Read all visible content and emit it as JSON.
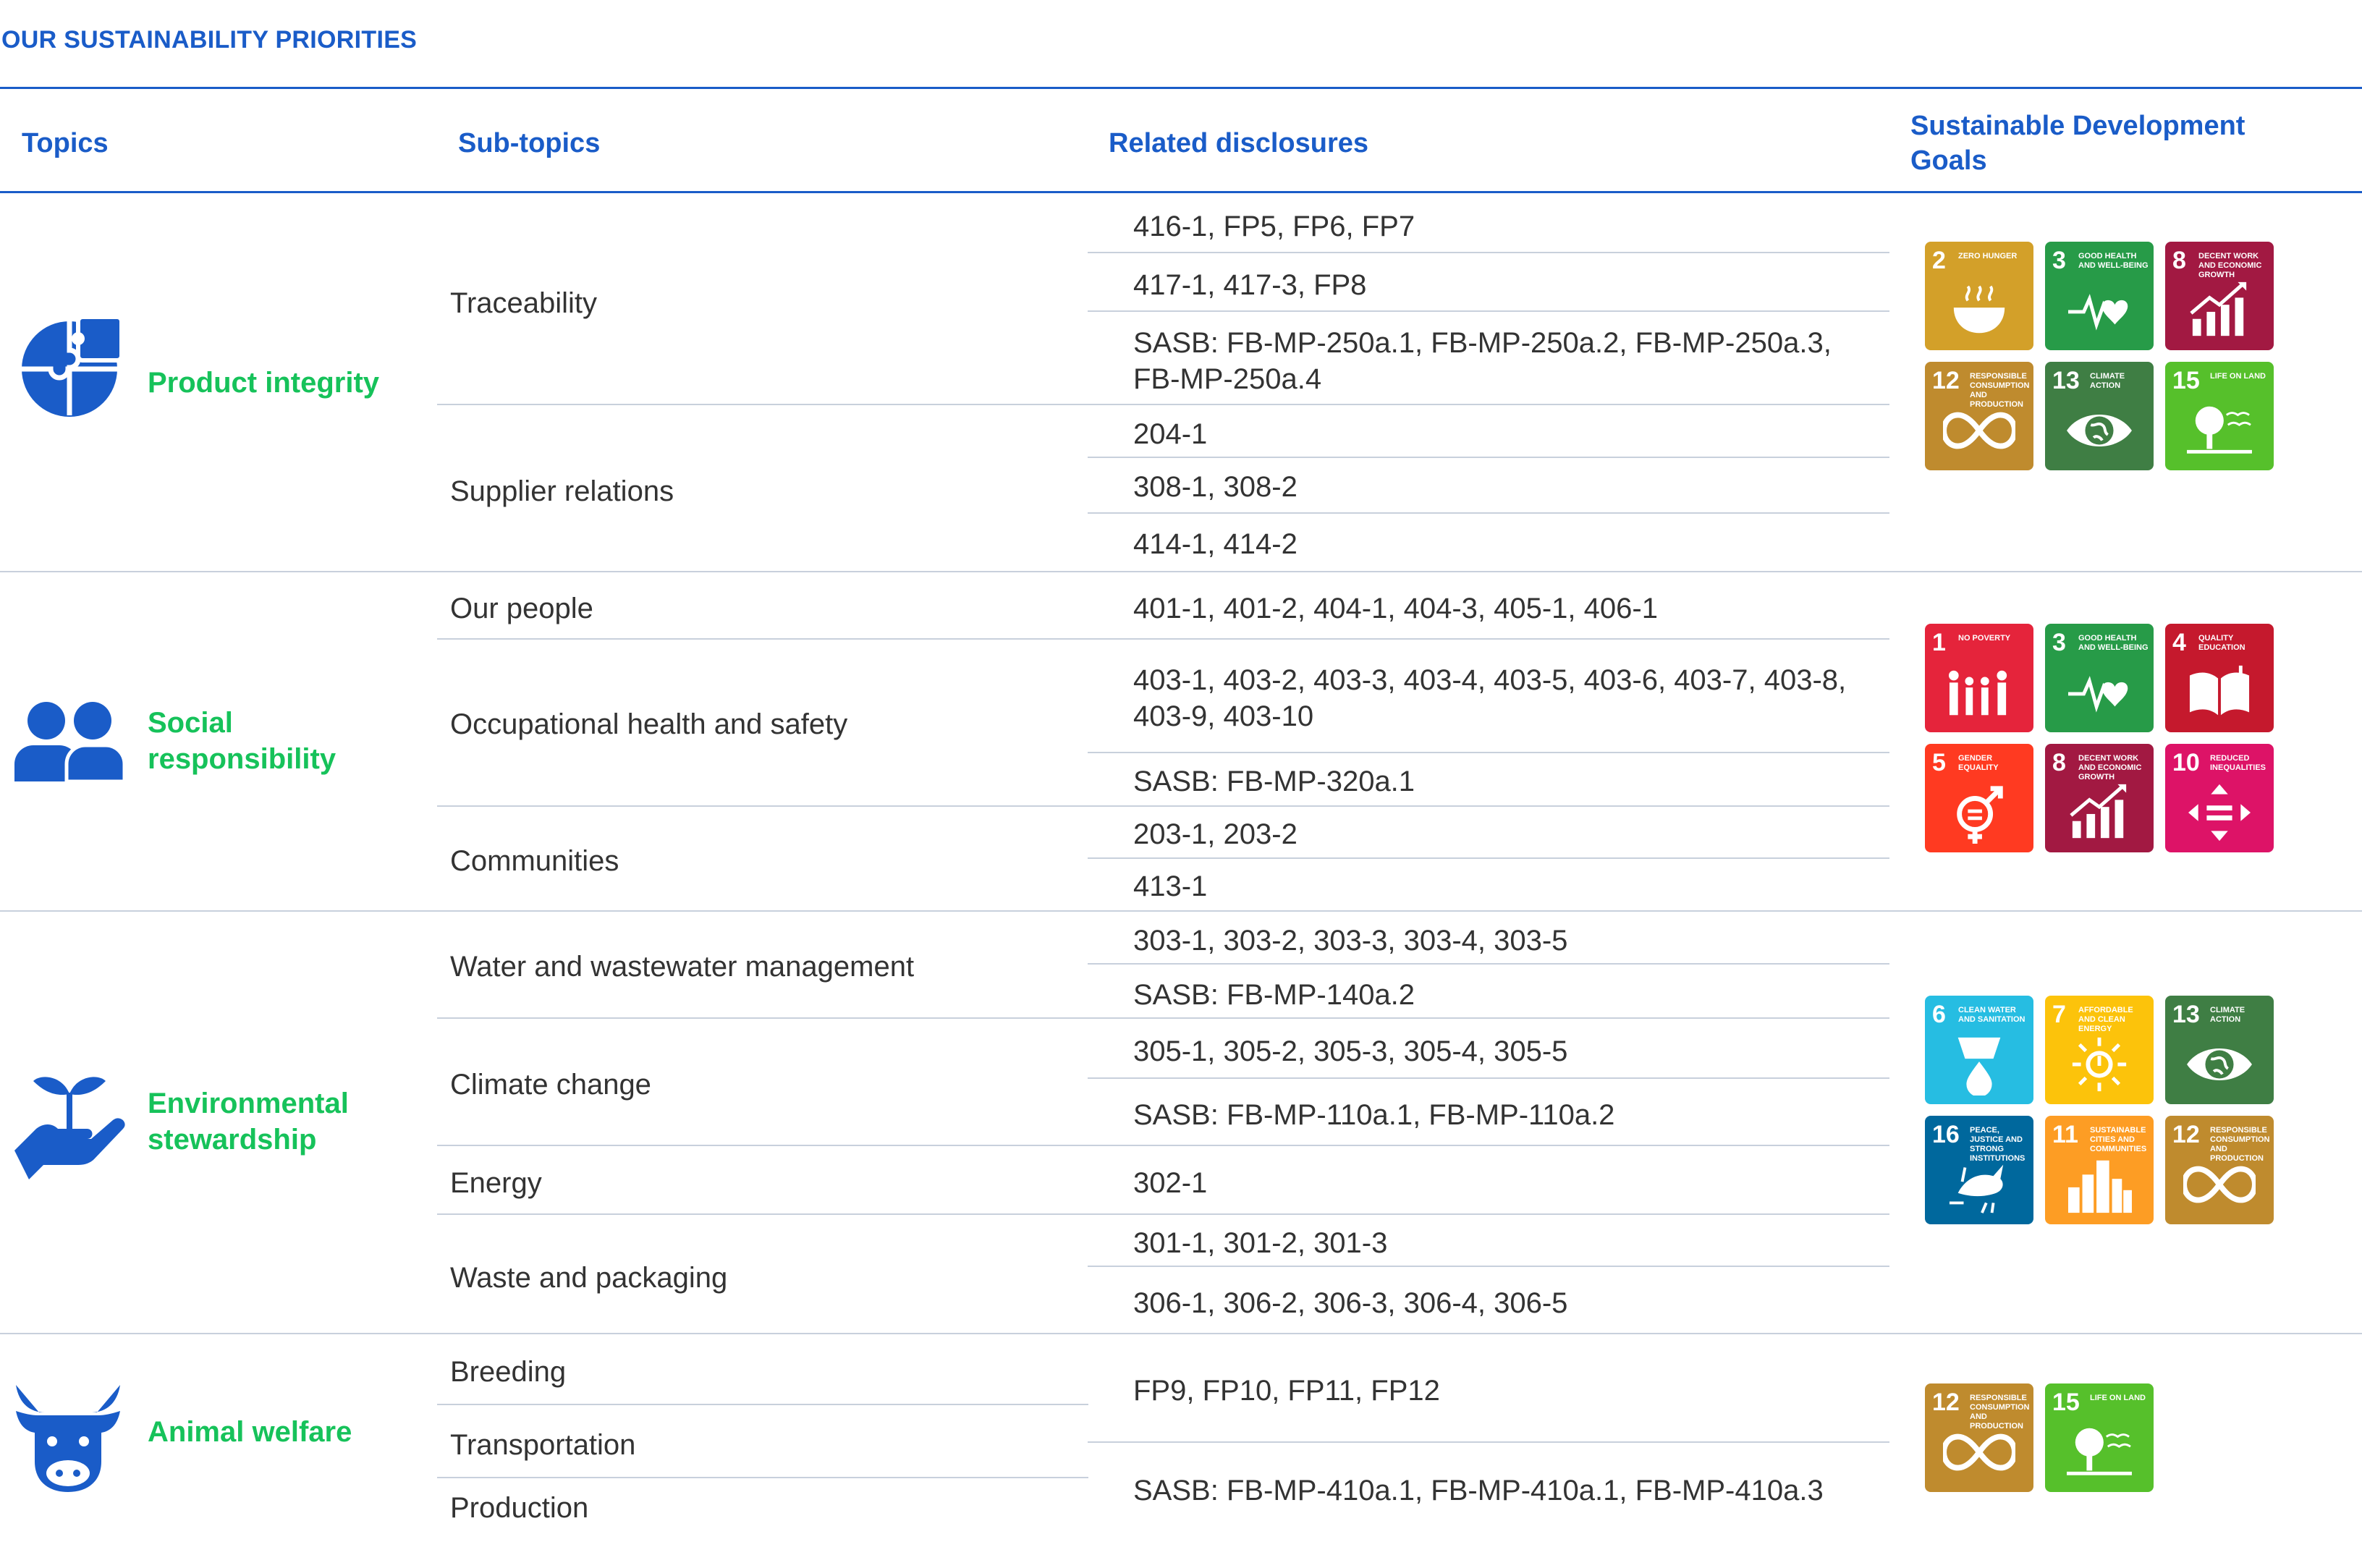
{
  "page_title": "OUR SUSTAINABILITY PRIORITIES",
  "headers": {
    "topics": "Topics",
    "subtopics": "Sub-topics",
    "disclosures": "Related disclosures",
    "sdg": "Sustainable Development Goals"
  },
  "colors": {
    "header_blue": "#1a5cc8",
    "topic_green": "#16c25a",
    "icon_blue": "#1a5cc8"
  },
  "sections": [
    {
      "topic": "Product integrity",
      "icon": "puzzle-globe-icon",
      "subtopics": [
        "Traceability",
        "Supplier relations"
      ],
      "disclosures": [
        "416-1, FP5, FP6, FP7",
        "417-1, 417-3, FP8",
        "SASB: FB-MP-250a.1, FB-MP-250a.2, FB-MP-250a.3, FB-MP-250a.4",
        "204-1",
        "308-1, 308-2",
        "414-1, 414-2"
      ],
      "sdgs": [
        {
          "num": "2",
          "label": "Zero hunger",
          "color": "#D3A029",
          "icon": "bowl-icon"
        },
        {
          "num": "3",
          "label": "Good health and well-being",
          "color": "#279B48",
          "icon": "heartbeat-icon"
        },
        {
          "num": "8",
          "label": "Decent work and economic growth",
          "color": "#A21942",
          "icon": "growth-chart-icon"
        },
        {
          "num": "12",
          "label": "Responsible consumption and production",
          "color": "#BF8B2E",
          "icon": "infinity-icon"
        },
        {
          "num": "13",
          "label": "Climate action",
          "color": "#3F7E44",
          "icon": "eye-globe-icon"
        },
        {
          "num": "15",
          "label": "Life on land",
          "color": "#56C02B",
          "icon": "tree-icon"
        }
      ]
    },
    {
      "topic": "Social responsibility",
      "icon": "people-icon",
      "subtopics": [
        "Our people",
        "Occupational health and safety",
        "Communities"
      ],
      "disclosures": [
        "401-1, 401-2, 404-1, 404-3, 405-1, 406-1",
        "403-1, 403-2, 403-3, 403-4, 403-5, 403-6, 403-7, 403-8, 403-9, 403-10",
        "SASB: FB-MP-320a.1",
        "203-1, 203-2",
        "413-1"
      ],
      "sdgs": [
        {
          "num": "1",
          "label": "No poverty",
          "color": "#E5243B",
          "icon": "family-icon"
        },
        {
          "num": "3",
          "label": "Good health and well-being",
          "color": "#279B48",
          "icon": "heartbeat-icon"
        },
        {
          "num": "4",
          "label": "Quality education",
          "color": "#C5192D",
          "icon": "book-icon"
        },
        {
          "num": "5",
          "label": "Gender equality",
          "color": "#FF3A21",
          "icon": "gender-icon"
        },
        {
          "num": "8",
          "label": "Decent work and economic growth",
          "color": "#A21942",
          "icon": "growth-chart-icon"
        },
        {
          "num": "10",
          "label": "Reduced inequalities",
          "color": "#DD1367",
          "icon": "equality-arrows-icon"
        }
      ]
    },
    {
      "topic": "Environmental stewardship",
      "icon": "hand-plant-icon",
      "subtopics": [
        "Water and wastewater management",
        "Climate change",
        "Energy",
        "Waste and packaging"
      ],
      "disclosures": [
        "303-1, 303-2, 303-3, 303-4, 303-5",
        "SASB: FB-MP-140a.2",
        "305-1, 305-2, 305-3, 305-4, 305-5",
        "SASB: FB-MP-110a.1, FB-MP-110a.2",
        "302-1",
        "301-1, 301-2, 301-3",
        "306-1, 306-2, 306-3, 306-4, 306-5"
      ],
      "sdgs": [
        {
          "num": "6",
          "label": "Clean water and sanitation",
          "color": "#26BDE2",
          "icon": "water-drop-icon"
        },
        {
          "num": "7",
          "label": "Affordable and clean energy",
          "color": "#FCC30B",
          "icon": "sun-power-icon"
        },
        {
          "num": "13",
          "label": "Climate action",
          "color": "#3F7E44",
          "icon": "eye-globe-icon"
        },
        {
          "num": "16",
          "label": "Peace, justice and strong institutions",
          "color": "#00689D",
          "icon": "dove-icon"
        },
        {
          "num": "11",
          "label": "Sustainable cities and communities",
          "color": "#FD9D24",
          "icon": "city-icon"
        },
        {
          "num": "12",
          "label": "Responsible consumption and production",
          "color": "#BF8B2E",
          "icon": "infinity-icon"
        }
      ]
    },
    {
      "topic": "Animal welfare",
      "icon": "cow-icon",
      "subtopics": [
        "Breeding",
        "Transportation",
        "Production"
      ],
      "disclosures": [
        "FP9, FP10, FP11, FP12",
        "SASB: FB-MP-410a.1, FB-MP-410a.1, FB-MP-410a.3"
      ],
      "sdgs": [
        {
          "num": "12",
          "label": "Responsible consumption and production",
          "color": "#BF8B2E",
          "icon": "infinity-icon"
        },
        {
          "num": "15",
          "label": "Life on land",
          "color": "#56C02B",
          "icon": "tree-icon"
        }
      ]
    }
  ]
}
